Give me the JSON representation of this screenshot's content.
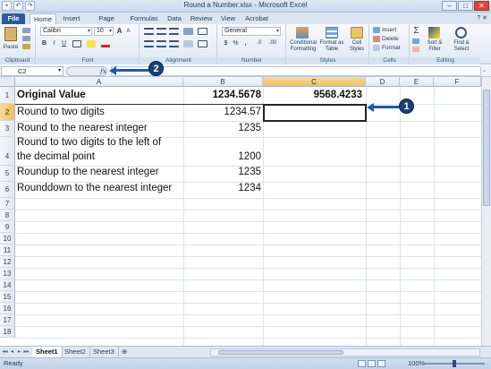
{
  "window": {
    "title": "Round a Number.xlsx - Microsoft Excel",
    "minimize": "–",
    "maximize": "□",
    "close": "✕"
  },
  "qat": [
    "▪",
    "↶",
    "↷"
  ],
  "tabs": {
    "file": "File",
    "items": [
      "Home",
      "Insert",
      "Page Layout",
      "Formulas",
      "Data",
      "Review",
      "View",
      "Acrobat"
    ],
    "help": "? ✕"
  },
  "ribbon": {
    "clipboard": {
      "paste": "Paste",
      "label": "Clipboard"
    },
    "font": {
      "name": "Calibri",
      "size": "10",
      "label": "Font",
      "bold": "B",
      "italic": "I",
      "underline": "U",
      "grow": "A",
      "shrink": "A"
    },
    "alignment": {
      "label": "Alignment"
    },
    "number": {
      "format": "General",
      "label": "Number",
      "currency": "$",
      "percent": "%",
      "comma": ",",
      "inc": ".0",
      "dec": ".00"
    },
    "styles": {
      "conditional": "Conditional Formatting",
      "format_table": "Format as Table",
      "cell_styles": "Cell Styles",
      "label": "Styles"
    },
    "cells": {
      "insert": "Insert",
      "delete": "Delete",
      "format": "Format",
      "label": "Cells"
    },
    "editing": {
      "sum": "Σ",
      "sort": "Sort & Filter",
      "find": "Find & Select",
      "label": "Editing"
    }
  },
  "formula_bar": {
    "name_box": "C2",
    "fx": "fx",
    "value": ""
  },
  "grid": {
    "columns": [
      "A",
      "B",
      "C",
      "D",
      "E",
      "F"
    ],
    "selected_column": "C",
    "rows": [
      "1",
      "2",
      "3",
      "4",
      "5",
      "6",
      "7",
      "8",
      "9",
      "10",
      "11",
      "12",
      "13",
      "14",
      "15",
      "16",
      "17",
      "18"
    ],
    "selected_row": "2",
    "cells": {
      "A1": "Original Value",
      "B1": "1234.5678",
      "C1": "9568.4233",
      "A2": "Round to two digits",
      "B2": "1234.57",
      "A3": "Round to the nearest integer",
      "B3": "1235",
      "A4a": "Round to two digits to the left of",
      "A4b": "the decimal point",
      "B4": "1200",
      "A5": "Roundup to the nearest integer",
      "B5": "1235",
      "A6": "Rounddown to the nearest integer",
      "B6": "1234"
    }
  },
  "callouts": {
    "one": "1",
    "two": "2"
  },
  "sheets": {
    "nav": [
      "◂◂",
      "◂",
      "▸",
      "▸▸"
    ],
    "tabs": [
      "Sheet1",
      "Sheet2",
      "Sheet3"
    ],
    "active": "Sheet1",
    "new_sheet": "⊕"
  },
  "status": {
    "ready": "Ready",
    "zoom": "100%",
    "zoom_fraction": 1.0
  }
}
